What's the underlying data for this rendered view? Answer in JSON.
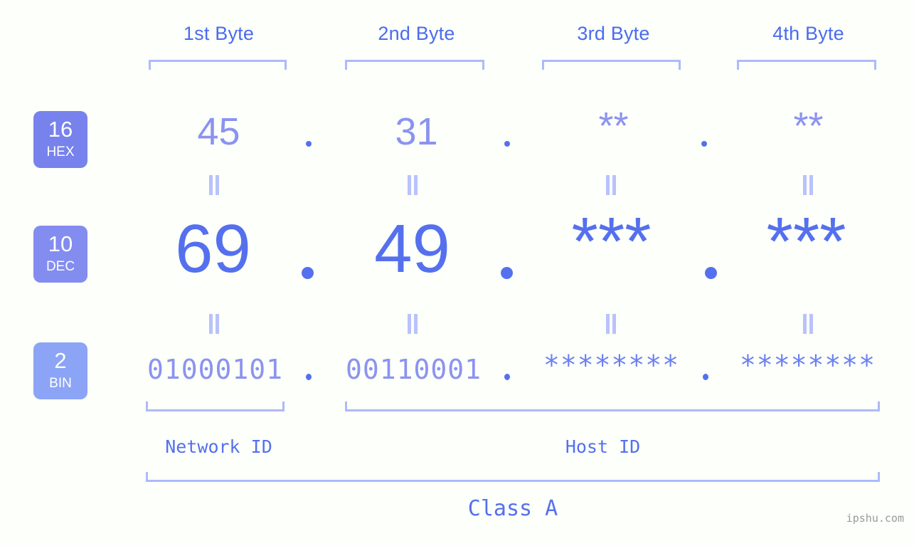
{
  "watermark": "ipshu.com",
  "byte_headers": [
    {
      "label": "1st Byte"
    },
    {
      "label": "2nd Byte"
    },
    {
      "label": "3rd Byte"
    },
    {
      "label": "4th Byte"
    }
  ],
  "bases": [
    {
      "number": "16",
      "name": "HEX",
      "color": "#7882ec"
    },
    {
      "number": "10",
      "name": "DEC",
      "color": "#838cef"
    },
    {
      "number": "2",
      "name": "BIN",
      "color": "#8ba4f5"
    }
  ],
  "rows": {
    "hex": {
      "base_number": "16",
      "base_name": "HEX",
      "values": [
        "45",
        "31",
        "**",
        "**"
      ],
      "separators": [
        ".",
        ".",
        "."
      ]
    },
    "dec": {
      "base_number": "10",
      "base_name": "DEC",
      "values": [
        "69",
        "49",
        "***",
        "***"
      ],
      "separators": [
        ".",
        ".",
        "."
      ]
    },
    "bin": {
      "base_number": "2",
      "base_name": "BIN",
      "values": [
        "01000101",
        "00110001",
        "********",
        "********"
      ],
      "separators": [
        ".",
        ".",
        "."
      ]
    }
  },
  "equals_marks": [
    "||",
    "||",
    "||",
    "||",
    "||",
    "||",
    "||",
    "||"
  ],
  "regions": [
    {
      "label": "Network ID"
    },
    {
      "label": "Host ID"
    }
  ],
  "class_label": "Class A",
  "colors": {
    "background": "#fcfffa",
    "accent_strong": "#5570ee",
    "accent_mid": "#8b93f0",
    "accent_light": "#aeb9fb",
    "header_text": "#4c6bef",
    "watermark_text": "#9a9a9a"
  }
}
